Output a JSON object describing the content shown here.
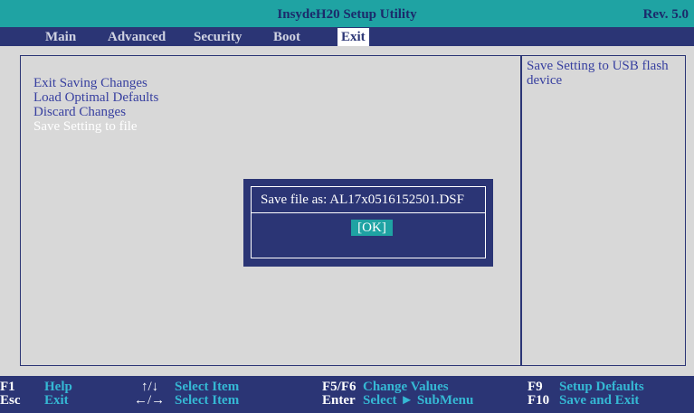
{
  "app": {
    "title": "InsydeH20 Setup Utility",
    "revision": "Rev. 5.0"
  },
  "menu": {
    "items": [
      {
        "label": "Main",
        "active": false
      },
      {
        "label": "Advanced",
        "active": false
      },
      {
        "label": "Security",
        "active": false
      },
      {
        "label": "Boot",
        "active": false
      },
      {
        "label": "Exit",
        "active": true
      }
    ]
  },
  "exit_menu": {
    "items": [
      {
        "label": "Exit Saving Changes",
        "selected": false
      },
      {
        "label": "Load Optimal Defaults",
        "selected": false
      },
      {
        "label": "Discard Changes",
        "selected": false
      },
      {
        "label": "Save Setting to file",
        "selected": true
      }
    ]
  },
  "help": {
    "text": "Save Setting to USB flash device"
  },
  "dialog": {
    "message": "Save file as: AL17x0516152501.DSF",
    "ok_label": "[OK]"
  },
  "footer": {
    "row1": [
      {
        "key": "F1",
        "desc": "Help"
      },
      {
        "key": "↑/↓",
        "desc": "Select Item"
      },
      {
        "key": "F5/F6",
        "desc": "Change Values"
      },
      {
        "key": "F9",
        "desc": "Setup Defaults"
      }
    ],
    "row2": [
      {
        "key": "Esc",
        "desc": "Exit"
      },
      {
        "key": "←/→",
        "desc": "Select Item"
      },
      {
        "key": "Enter",
        "desc": "Select ► SubMenu"
      },
      {
        "key": "F10",
        "desc": "Save and Exit"
      }
    ]
  },
  "colors": {
    "title_bar": "#1fa3a3",
    "menu_bar": "#2b3575",
    "panel_bg": "#d8d8d8",
    "item_text": "#3840a0",
    "footer_desc": "#35b8d4"
  }
}
